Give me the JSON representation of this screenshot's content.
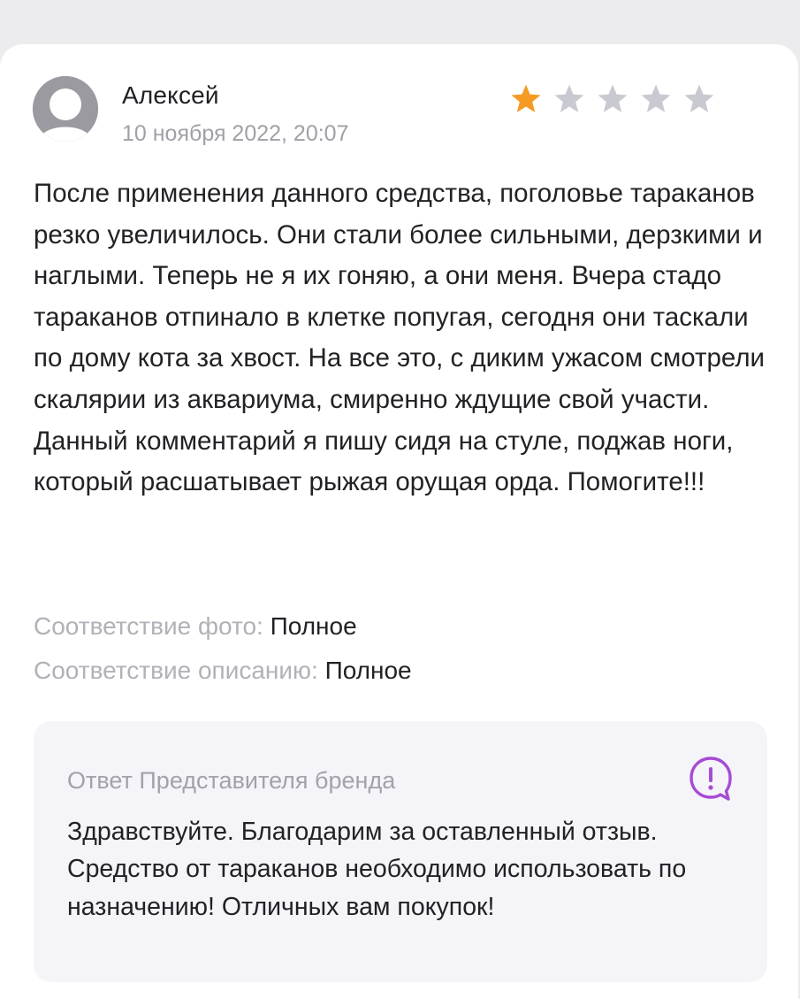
{
  "review": {
    "author": "Алексей",
    "date": "10 ноября 2022, 20:07",
    "rating": 1,
    "max_rating": 5,
    "text": "После применения данного средства, поголовье тараканов резко увеличилось. Они стали более сильными, дерзкими и наглыми. Теперь не я их гоняю, а они меня. Вчера стадо тараканов отпинало в клетке попугая, сегодня они таскали по дому кота за хвост. На все это, с диким ужасом смотрели скалярии из аквариума, смиренно ждущие свой участи. Данный комментарий я пишу сидя на стуле, поджав ноги, который расшатывает рыжая орущая орда. Помогите!!!",
    "attributes": [
      {
        "label": "Соответствие фото:",
        "value": "Полное"
      },
      {
        "label": "Соответствие описанию:",
        "value": "Полное"
      }
    ]
  },
  "brand_reply": {
    "title": "Ответ Представителя бренда",
    "icon": "question-bubble-icon",
    "text": "Здравствуйте. Благодарим за оставленный отзыв. Средство от тараканов необходимо использовать по назначению! Отличных вам покупок!"
  },
  "colors": {
    "star_filled": "#f59a23",
    "star_empty": "#c9c9d1",
    "brand_icon": "#a64bd4",
    "muted_text": "#a0a0a8"
  }
}
